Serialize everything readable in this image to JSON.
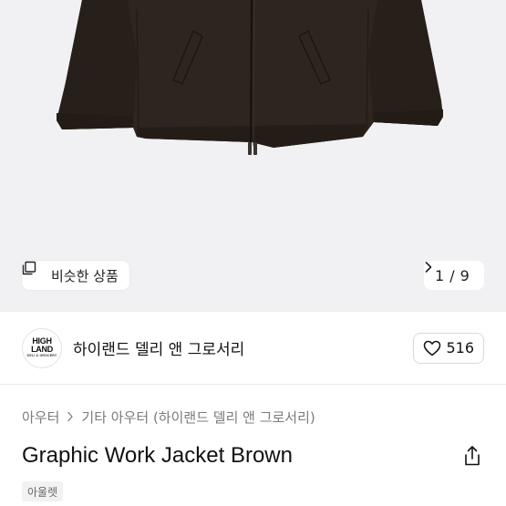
{
  "image_viewer": {
    "similar_button_label": "비슷한 상품",
    "page_current": "1",
    "page_separator": "/",
    "page_total": "9",
    "background_color": "#f1f1f3",
    "jacket_color": "#2d251e"
  },
  "brand": {
    "logo_line1": "HIGH",
    "logo_line2": "LAND",
    "logo_line3": "DELI & GROCERY",
    "name": "하이랜드 델리 앤 그로서리",
    "like_count": "516"
  },
  "product": {
    "breadcrumb": [
      "아우터",
      "기타 아우터 (하이랜드 델리 앤 그로서리)"
    ],
    "title": "Graphic Work Jacket Brown",
    "tag": "아울렛"
  }
}
